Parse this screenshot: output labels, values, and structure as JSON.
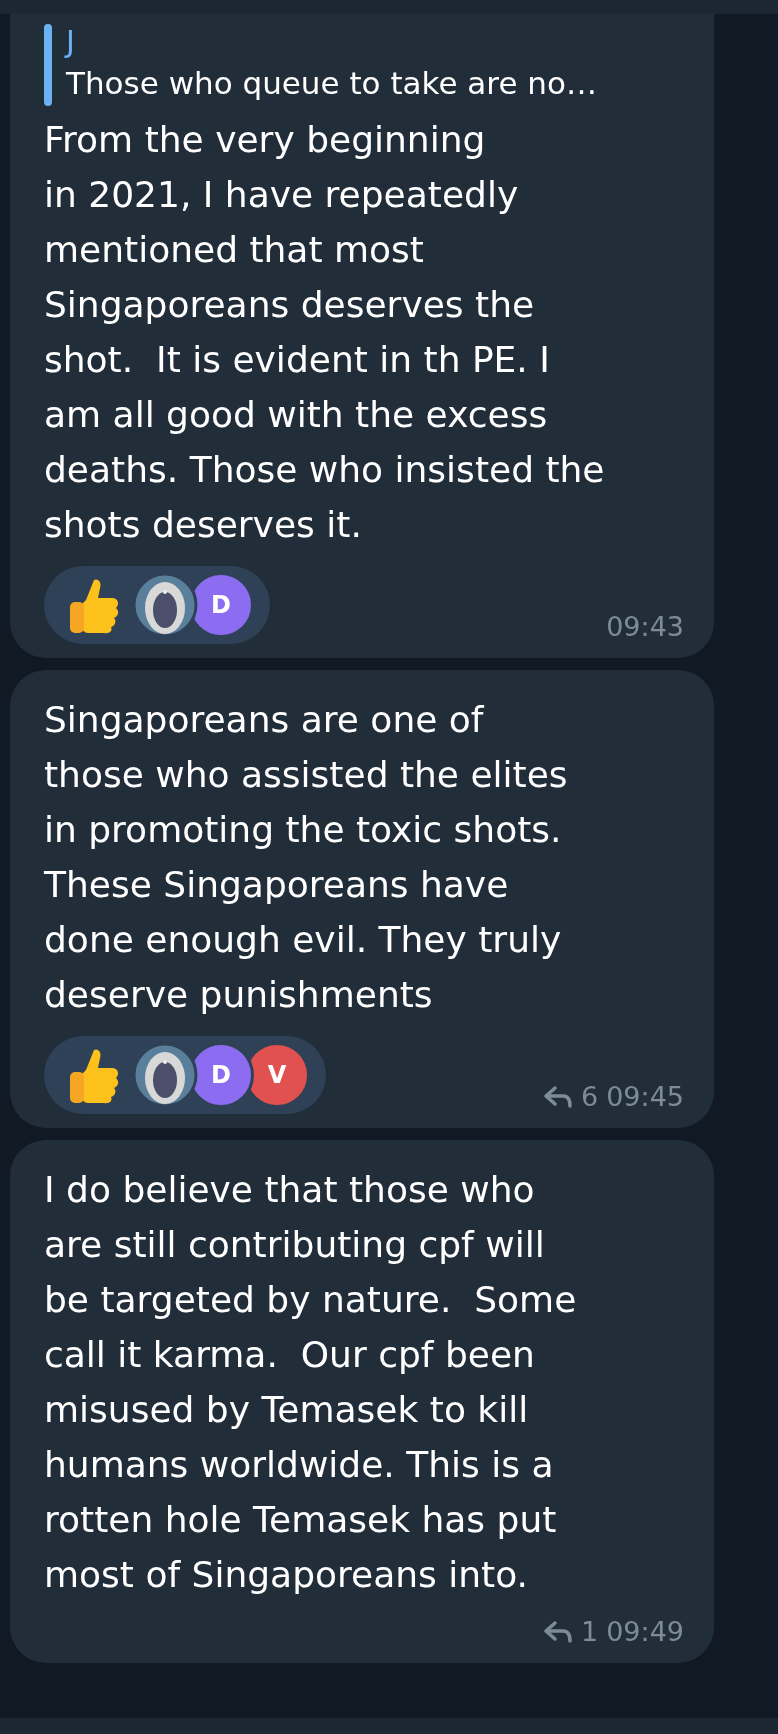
{
  "messages": [
    {
      "quote": {
        "author": "J",
        "text": "Those who queue to take are no…"
      },
      "text": "From the very beginning\nin 2021, I have repeatedly\nmentioned that most\nSingaporeans deserves the\nshot.  It is evident in th PE. I\nam all good with the excess\ndeaths. Those who insisted the\nshots deserves it.",
      "reactions": [
        {
          "kind": "picture"
        },
        {
          "kind": "letter",
          "letter": "D",
          "color": "#8c6cf0"
        }
      ],
      "time": "09:43"
    },
    {
      "text": "Singaporeans are one of\nthose who assisted the elites\nin promoting the toxic shots.\nThese Singaporeans have\ndone enough evil. They truly\ndeserve punishments",
      "reactions": [
        {
          "kind": "picture"
        },
        {
          "kind": "letter",
          "letter": "D",
          "color": "#8c6cf0"
        },
        {
          "kind": "letter",
          "letter": "V",
          "color": "#e0514f"
        }
      ],
      "replies": "6",
      "time": "09:45"
    },
    {
      "text": "I do believe that those who\nare still contributing cpf will\nbe targeted by nature.  Some\ncall it karma.  Our cpf been\nmisused by Temasek to kill\nhumans worldwide. This is a\nrotten hole Temasek has put\nmost of Singaporeans into.",
      "replies": "1",
      "time": "09:49"
    }
  ]
}
